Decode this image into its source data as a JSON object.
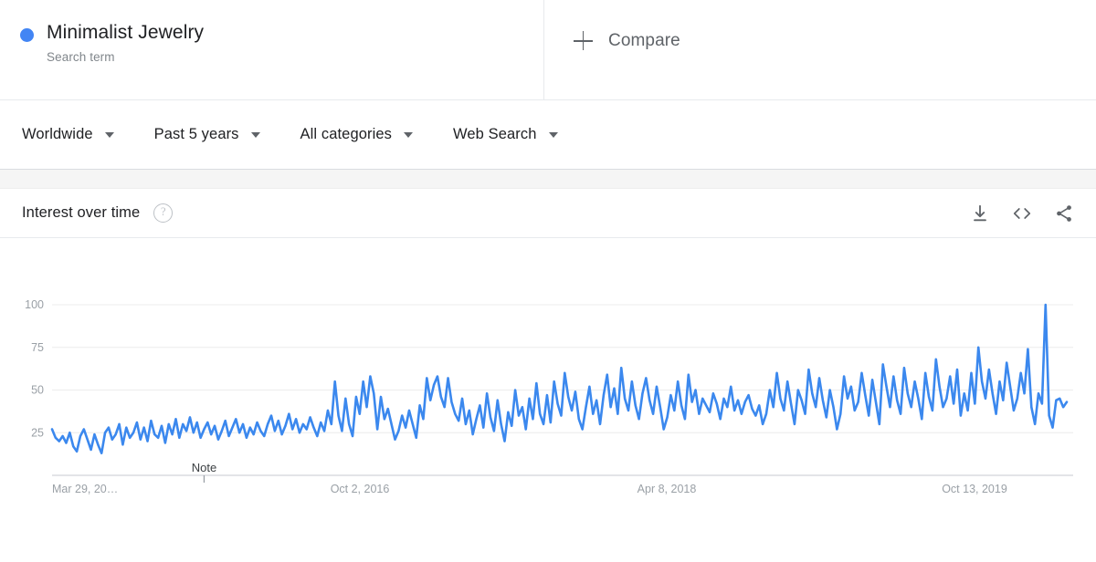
{
  "term": {
    "title": "Minimalist Jewelry",
    "subtitle": "Search term",
    "dot_color": "#4285f4"
  },
  "compare": {
    "label": "Compare",
    "icon": "plus-icon"
  },
  "filters": [
    {
      "label": "Worldwide",
      "icon": "chevron-down-icon"
    },
    {
      "label": "Past 5 years",
      "icon": "chevron-down-icon"
    },
    {
      "label": "All categories",
      "icon": "chevron-down-icon"
    },
    {
      "label": "Web Search",
      "icon": "chevron-down-icon"
    }
  ],
  "card": {
    "title": "Interest over time",
    "help_icon": "help-circle-icon",
    "help_glyph": "?",
    "actions": [
      {
        "name": "download-icon",
        "tooltip": "Download"
      },
      {
        "name": "embed-code-icon",
        "tooltip": "Embed"
      },
      {
        "name": "share-icon",
        "tooltip": "Share"
      }
    ]
  },
  "chart_data": {
    "type": "line",
    "title": "Interest over time",
    "xlabel": "",
    "ylabel": "",
    "ylim": [
      0,
      100
    ],
    "grid": true,
    "legend": "none",
    "line_color": "#3b88ee",
    "annotation": {
      "text": "Note",
      "x_index": 43
    },
    "x_tick_labels": [
      "Mar 29, 20…",
      "Oct 2, 2016",
      "Apr 8, 2018",
      "Oct 13, 2019"
    ],
    "x_tick_positions": [
      0,
      79,
      158,
      237
    ],
    "y_tick_labels": [
      "25",
      "50",
      "75",
      "100"
    ],
    "y_ticks": [
      25,
      50,
      75,
      100
    ],
    "series": [
      {
        "name": "Minimalist Jewelry",
        "color": "#3b88ee",
        "values": [
          27,
          22,
          20,
          23,
          19,
          25,
          17,
          14,
          23,
          27,
          21,
          15,
          24,
          18,
          13,
          25,
          28,
          21,
          24,
          30,
          18,
          28,
          22,
          25,
          31,
          21,
          28,
          20,
          32,
          24,
          22,
          29,
          19,
          30,
          24,
          33,
          22,
          30,
          26,
          34,
          25,
          31,
          22,
          27,
          31,
          24,
          29,
          21,
          26,
          32,
          23,
          28,
          33,
          25,
          30,
          22,
          28,
          24,
          31,
          26,
          23,
          30,
          35,
          26,
          32,
          24,
          29,
          36,
          27,
          33,
          25,
          30,
          27,
          34,
          28,
          23,
          31,
          26,
          38,
          30,
          55,
          35,
          26,
          45,
          30,
          23,
          46,
          36,
          55,
          40,
          58,
          48,
          27,
          46,
          33,
          39,
          30,
          21,
          26,
          35,
          28,
          38,
          30,
          22,
          41,
          33,
          57,
          44,
          53,
          58,
          46,
          40,
          57,
          43,
          36,
          32,
          45,
          30,
          38,
          24,
          33,
          41,
          28,
          48,
          34,
          26,
          44,
          30,
          20,
          37,
          29,
          50,
          35,
          40,
          27,
          45,
          33,
          54,
          36,
          30,
          47,
          31,
          55,
          42,
          35,
          60,
          46,
          38,
          49,
          33,
          27,
          40,
          52,
          36,
          44,
          30,
          47,
          59,
          40,
          51,
          36,
          63,
          45,
          38,
          55,
          41,
          33,
          48,
          57,
          44,
          36,
          52,
          40,
          27,
          34,
          47,
          38,
          55,
          41,
          33,
          59,
          43,
          50,
          36,
          45,
          41,
          37,
          48,
          42,
          33,
          45,
          40,
          52,
          38,
          44,
          36,
          43,
          47,
          39,
          35,
          41,
          30,
          36,
          50,
          40,
          60,
          45,
          38,
          55,
          42,
          30,
          50,
          44,
          36,
          62,
          48,
          40,
          57,
          44,
          34,
          50,
          40,
          27,
          36,
          58,
          45,
          52,
          38,
          43,
          60,
          47,
          35,
          56,
          43,
          30,
          65,
          52,
          40,
          58,
          44,
          36,
          63,
          48,
          40,
          55,
          45,
          33,
          60,
          46,
          38,
          68,
          52,
          40,
          45,
          58,
          42,
          62,
          35,
          48,
          38,
          60,
          42,
          75,
          55,
          45,
          62,
          48,
          36,
          55,
          44,
          66,
          52,
          38,
          45,
          60,
          48,
          74,
          40,
          30,
          48,
          42,
          100,
          35,
          28,
          44,
          45,
          40,
          43
        ]
      }
    ]
  }
}
